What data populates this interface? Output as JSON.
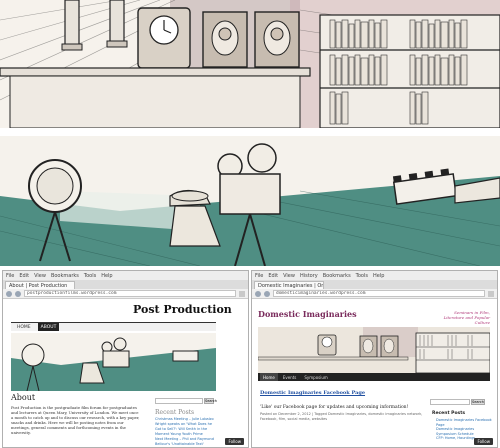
{
  "left_browser": {
    "menu": [
      "File",
      "Edit",
      "View",
      "Bookmarks",
      "Tools",
      "Help"
    ],
    "tab_title": "About | Post Production",
    "url": "postproductionfilms.wordpress.com",
    "site_title": "Post Production",
    "nav": [
      "HOME",
      "ABOUT"
    ],
    "heading": "About",
    "intro": "Post Production is the postgraduate film forum for postgraduates and lecturers at Queen Mary, University of London. We meet once a month to catch up and to discuss our research, with a key paper, snacks and drinks. Here we will be posting notes from our meetings, general comments and forthcoming events in the university.",
    "search_button": "Search",
    "sidebar_heading": "Recent Posts",
    "recent_posts": [
      "Christmas Meeting – Julie Lobalzo Wright speaks on 'What Does he Got to Sell?': Will Smith in the Moment Young Youth Prime",
      "Next Meeting – Phil and Raymond Bellour's 'Unattainable Text'"
    ],
    "follow": "Follow"
  },
  "right_browser": {
    "menu": [
      "File",
      "Edit",
      "View",
      "History",
      "Bookmarks",
      "Tools",
      "Help"
    ],
    "tab_title": "Domestic Imaginaries | On...",
    "url": "domesticimaginaries.wordpress.com",
    "site_title": "Domestic Imaginaries",
    "tagline": "Seminars in Film, Literature and Popular Culture",
    "nav": [
      "Home",
      "Events",
      "Symposium"
    ],
    "post_title": "Domestic Imaginaries Facebook Page",
    "post_body": "'Like' our Facebook page for updates and upcoming information!",
    "post_meta": "Posted on December 2, 2012 | Tagged Domestic Imaginaries, domestic imaginaries network, Facebook, film, social media, websites",
    "search_button": "Search",
    "sidebar_heading": "Recent Posts",
    "recent_posts": [
      "Domestic Imaginaries Facebook Page",
      "Domestic Imaginaries Symposium Schedule",
      "CFP: Home, Hauntings"
    ],
    "follow": "Follow"
  }
}
